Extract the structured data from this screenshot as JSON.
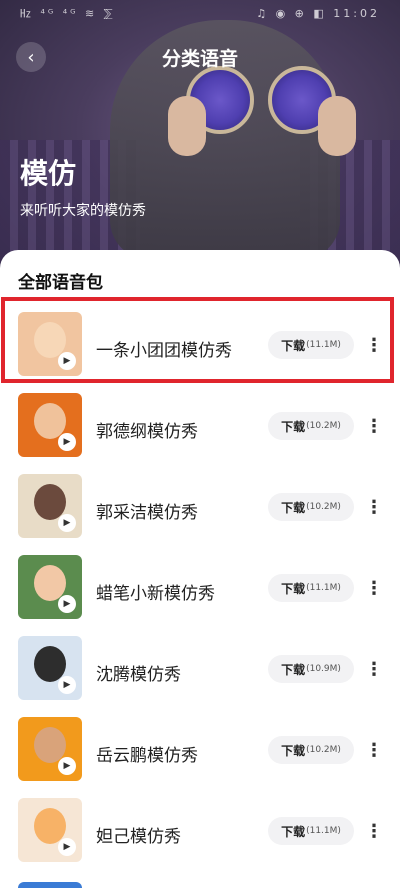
{
  "status_bar": {
    "left": "㎐ ⁴ᴳ ⁴ᴳ ≋ ⅀",
    "right": "♫ ◉ ⊕ ◧ 11:02"
  },
  "header": {
    "title": "分类语音",
    "back_icon": "chevron-left-icon"
  },
  "hero": {
    "title": "模仿",
    "subtitle": "来听听大家的模仿秀"
  },
  "section": {
    "title": "全部语音包"
  },
  "download_label": "下载",
  "items": [
    {
      "name": "一条小团团模仿秀",
      "size": "(11.1M)",
      "color": "#f1c5a0",
      "face": "#f7d7b7"
    },
    {
      "name": "郭德纲模仿秀",
      "size": "(10.2M)",
      "color": "#e46f1e",
      "face": "#f0c29b"
    },
    {
      "name": "郭采洁模仿秀",
      "size": "(10.2M)",
      "color": "#e8dcc7",
      "face": "#6b4a3d"
    },
    {
      "name": "蜡笔小新模仿秀",
      "size": "(11.1M)",
      "color": "#5b8c4e",
      "face": "#f2c8a6"
    },
    {
      "name": "沈腾模仿秀",
      "size": "(10.9M)",
      "color": "#d7e3f0",
      "face": "#2d2d2d"
    },
    {
      "name": "岳云鹏模仿秀",
      "size": "(10.2M)",
      "color": "#f29a1c",
      "face": "#d9a37a"
    },
    {
      "name": "妲己模仿秀",
      "size": "(11.1M)",
      "color": "#f6e6d5",
      "face": "#f7b267"
    }
  ]
}
